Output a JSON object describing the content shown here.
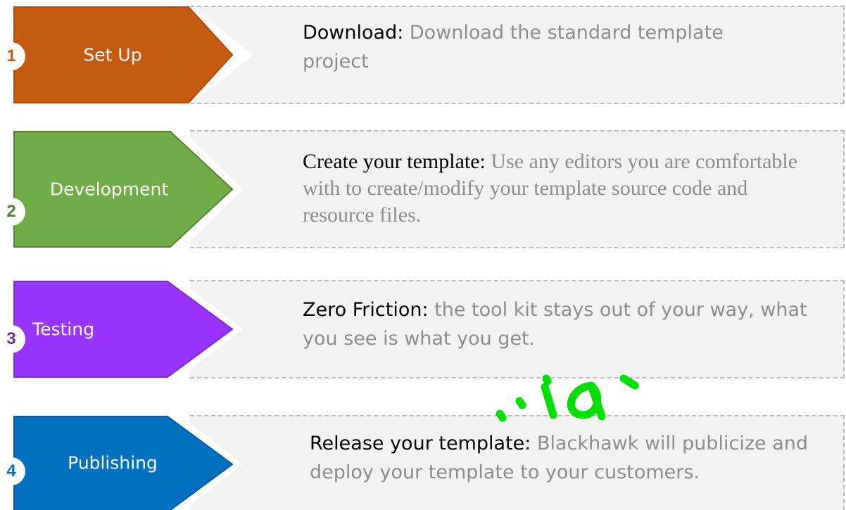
{
  "steps": [
    {
      "number": "1",
      "label": "Set Up",
      "color": "#c55a11",
      "lead": "Download:",
      "text": " Download the standard template project"
    },
    {
      "number": "2",
      "label": "Development",
      "color": "#70ad47",
      "lead": "Create your template:",
      "text": " Use any editors you are comfortable with to create/modify your template source code and resource files."
    },
    {
      "number": "3",
      "label": "Testing",
      "color": "#9933ff",
      "lead": "Zero Friction:",
      "text": " the tool kit stays out of your way, what you see is what you get."
    },
    {
      "number": "4",
      "label": "Publishing",
      "color": "#0070c0",
      "lead": "Release your template:",
      "text": " Blackhawk will publicize and deploy your template to your customers."
    }
  ],
  "colors": {
    "panel_bg": "#f2f2f2",
    "panel_border": "#bdbdbd",
    "description_text": "#8c8c8c",
    "watermark": "#00e000"
  }
}
